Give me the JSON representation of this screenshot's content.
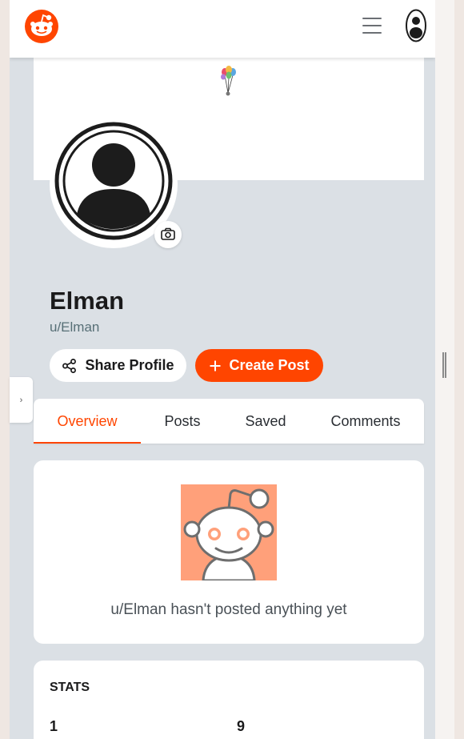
{
  "brand": {
    "accent": "#ff4500",
    "logo_icon": "reddit-snoo-logo-icon"
  },
  "header": {
    "menu_icon": "hamburger-menu-icon",
    "avatar_icon": "user-avatar-icon"
  },
  "profile": {
    "display_name": "Elman",
    "username": "u/Elman",
    "share_label": "Share Profile",
    "create_label": "Create Post",
    "camera_icon": "camera-icon",
    "banner_icon": "balloons-icon"
  },
  "sidebar_toggle": {
    "label": "›"
  },
  "tabs": [
    {
      "label": "Overview",
      "active": true
    },
    {
      "label": "Posts",
      "active": false
    },
    {
      "label": "Saved",
      "active": false
    },
    {
      "label": "Comments",
      "active": false
    }
  ],
  "empty_state": {
    "message": "u/Elman hasn't posted anything yet",
    "illustration": "snoo-illustration-icon"
  },
  "stats": {
    "title": "STATS",
    "values": [
      "1",
      "9"
    ]
  }
}
